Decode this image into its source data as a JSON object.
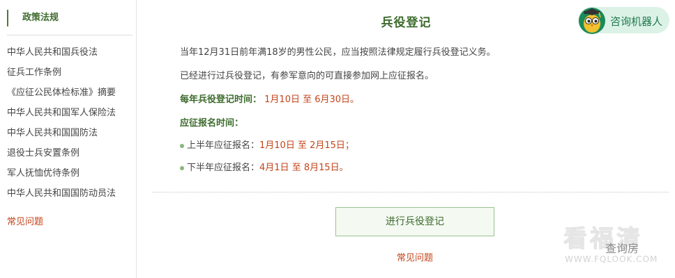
{
  "sidebar": {
    "heading": "政策法规",
    "items": [
      {
        "label": "中华人民共和国兵役法"
      },
      {
        "label": "征兵工作条例"
      },
      {
        "label": "《应征公民体检标准》摘要"
      },
      {
        "label": "中华人民共和国军人保险法"
      },
      {
        "label": "中华人民共和国国防法"
      },
      {
        "label": "退役士兵安置条例"
      },
      {
        "label": "军人抚恤优待条例"
      },
      {
        "label": "中华人民共和国国防动员法"
      }
    ],
    "faq_link": "常见问题"
  },
  "main": {
    "title": "兵役登记",
    "robot_button": "咨询机器人",
    "para1": "当年12月31日前年满18岁的男性公民，应当按照法律规定履行兵役登记义务。",
    "para2": "已经进行过兵役登记，有参军意向的可直接参加网上应征报名。",
    "registration_time_label": "每年兵役登记时间：",
    "registration_time_value": "1月10日 至 6月30日。",
    "enlist_time_label": "应征报名时间：",
    "first_half_label": "上半年应征报名：",
    "first_half_value": "1月10日 至 2月15日；",
    "second_half_label": "下半年应征报名：",
    "second_half_value": "4月1日 至 8月15日。",
    "register_button": "进行兵役登记",
    "faq_link": "常见问题"
  },
  "watermark": {
    "main": "看福清",
    "overlay": "查询房",
    "url": "WWW.FQLOOK.COM"
  },
  "colors": {
    "accent_green": "#3d6b2d",
    "link_red": "#c2441a",
    "robot_bg": "#ddf2e7",
    "button_bg": "#f4f9f2"
  }
}
